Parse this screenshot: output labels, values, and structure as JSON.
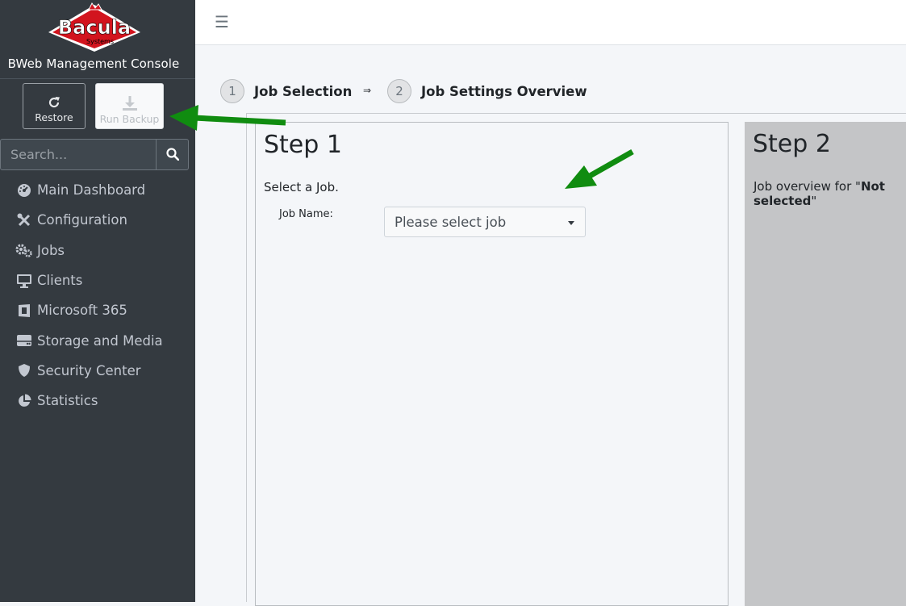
{
  "brand": {
    "logo_text": "Bacula",
    "logo_subtext": "Systems",
    "title": "BWeb Management Console"
  },
  "actions": {
    "restore_label": "Restore",
    "run_backup_label": "Run Backup"
  },
  "search": {
    "placeholder": "Search..."
  },
  "nav": [
    {
      "label": "Main Dashboard",
      "icon": "dashboard-icon"
    },
    {
      "label": "Configuration",
      "icon": "tools-icon"
    },
    {
      "label": "Jobs",
      "icon": "cogs-icon"
    },
    {
      "label": "Clients",
      "icon": "desktop-icon"
    },
    {
      "label": "Microsoft 365",
      "icon": "office-icon"
    },
    {
      "label": "Storage and Media",
      "icon": "hdd-icon"
    },
    {
      "label": "Security Center",
      "icon": "shield-icon"
    },
    {
      "label": "Statistics",
      "icon": "pie-chart-icon"
    }
  ],
  "wizard": {
    "steps": [
      {
        "number": "1",
        "label": "Job Selection"
      },
      {
        "number": "2",
        "label": "Job Settings Overview"
      }
    ],
    "arrow": "⇒"
  },
  "step1": {
    "title": "Step 1",
    "description": "Select a Job.",
    "job_name_label": "Job Name:",
    "job_select_value": "Please select job"
  },
  "step2": {
    "title": "Step 2",
    "overview_prefix": "Job overview for \"",
    "overview_value": "Not selected",
    "overview_suffix": "\""
  },
  "colors": {
    "sidebar_bg": "#343a40",
    "content_bg": "#f4f6f9",
    "annotation_arrow": "#108c10",
    "logo_red": "#d2141e"
  }
}
